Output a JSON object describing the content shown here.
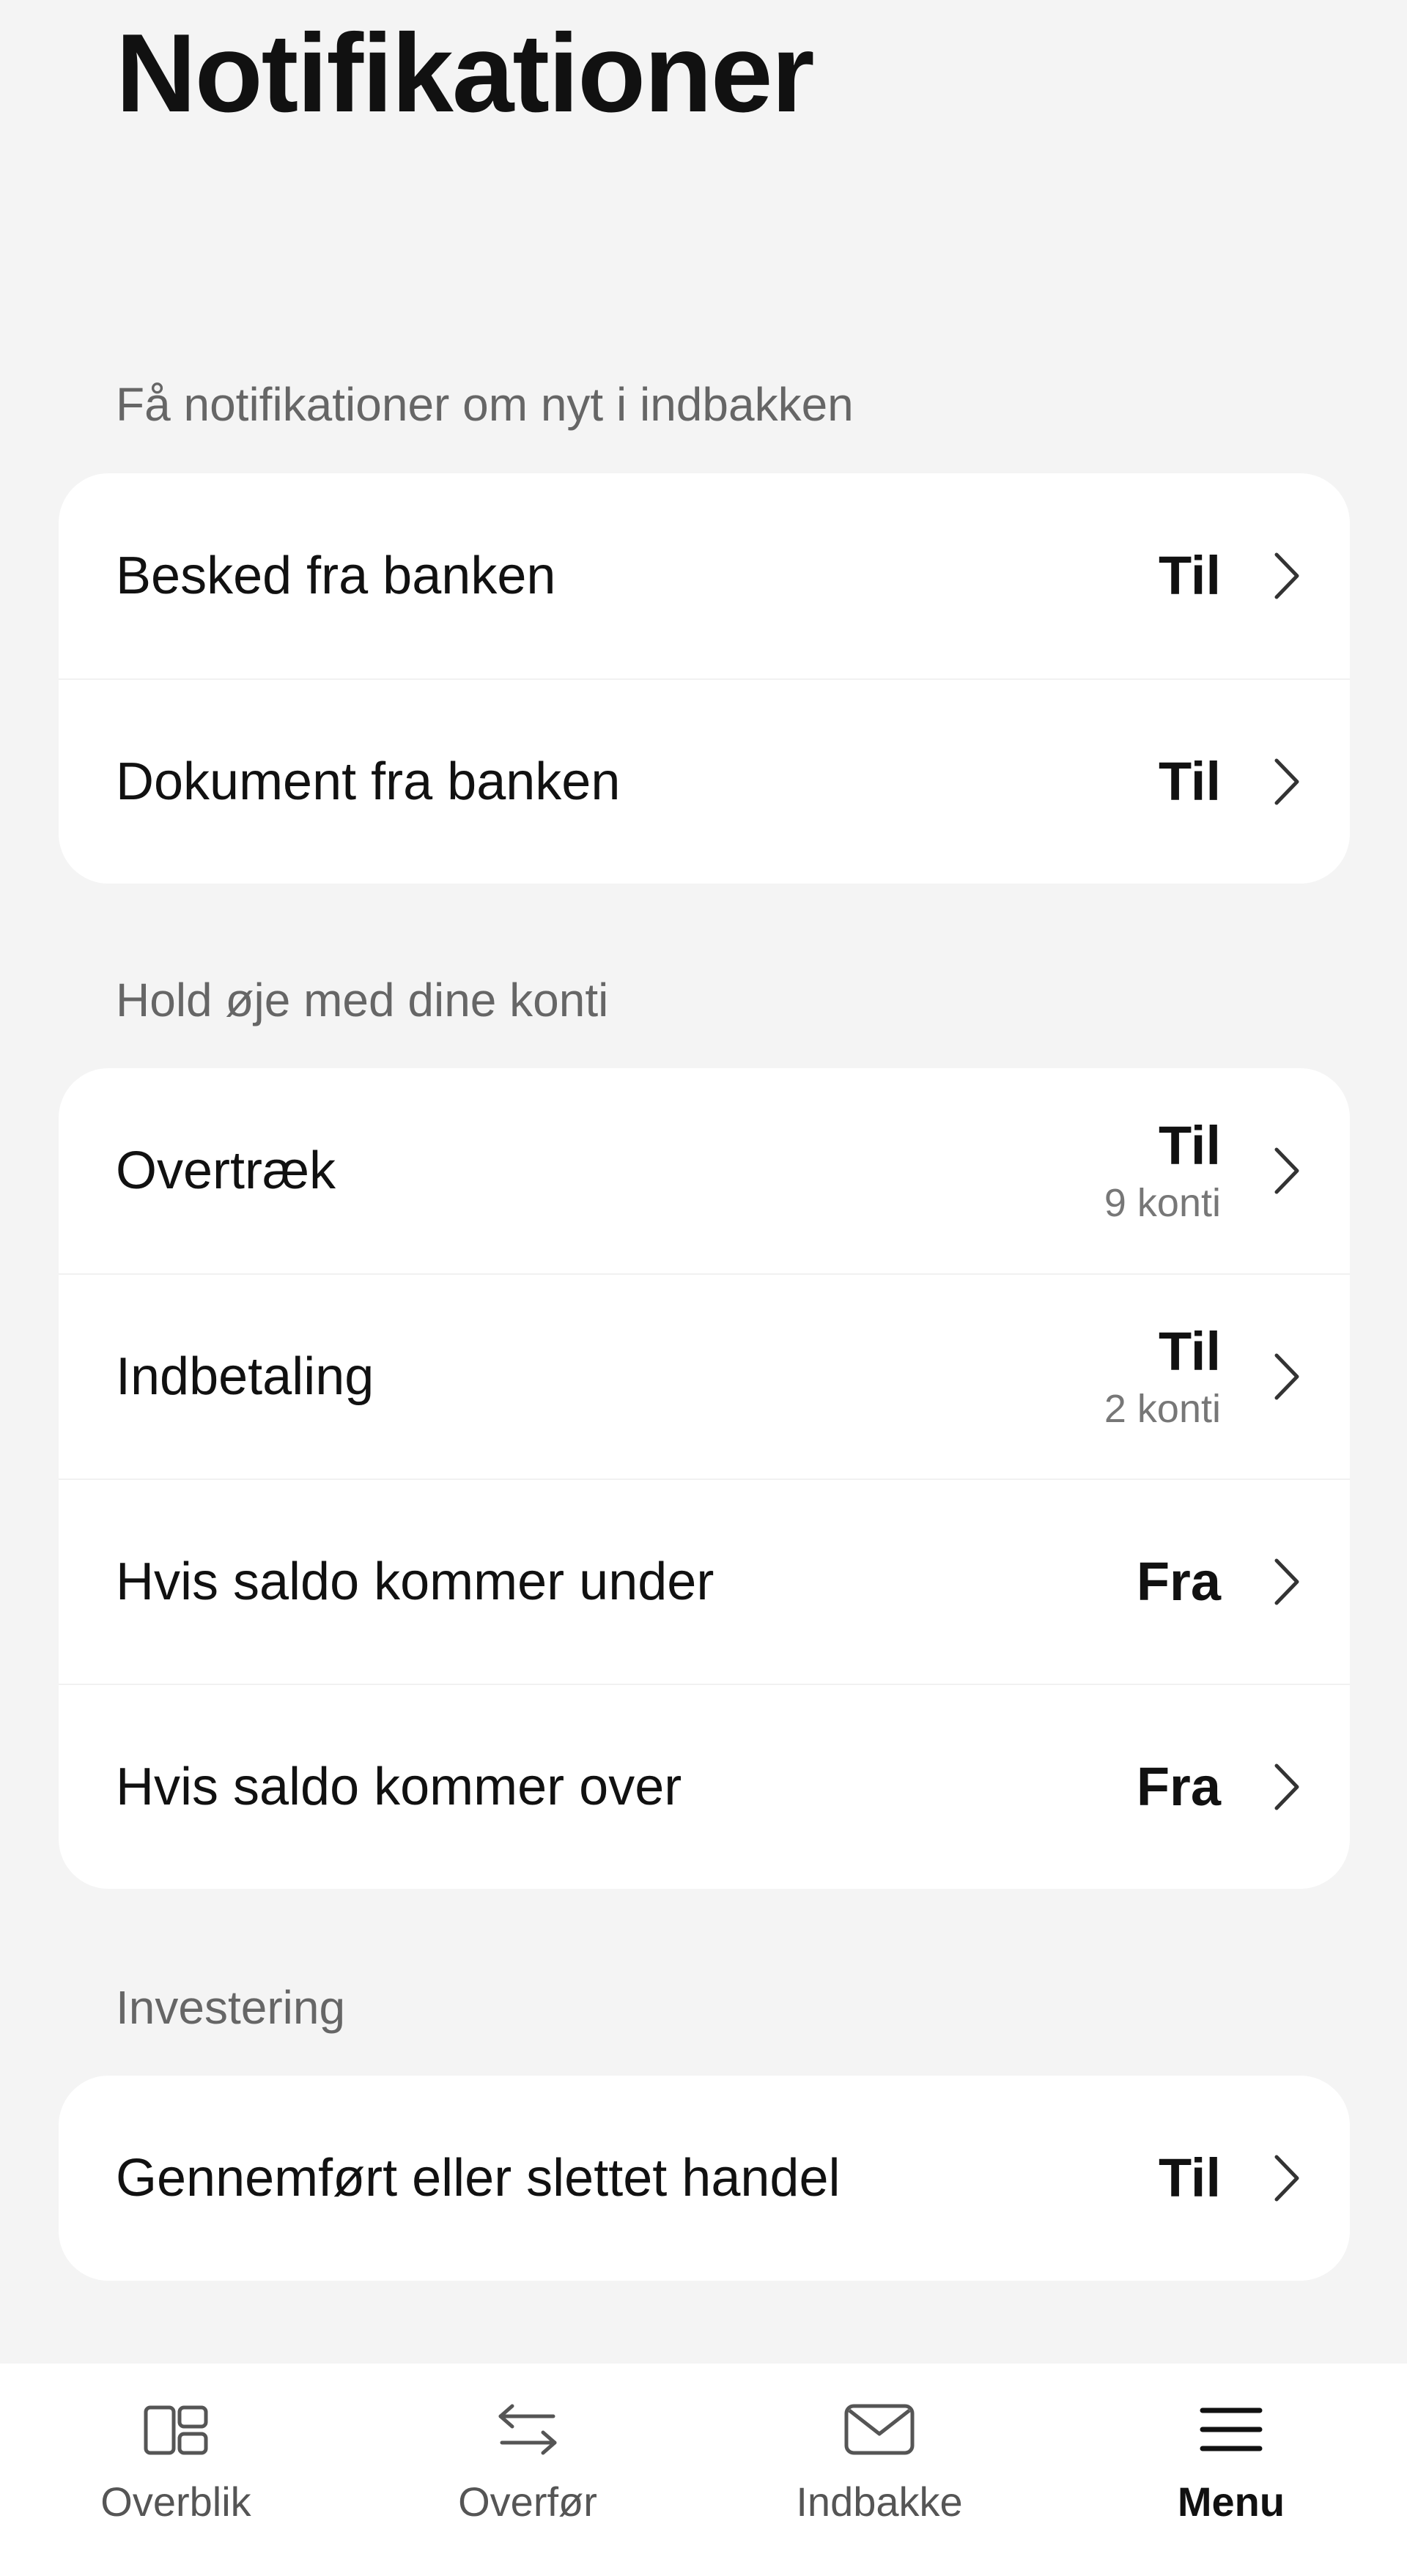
{
  "header": {
    "title": "Notifikationer"
  },
  "sections": [
    {
      "label": "Få notifikationer om nyt i indbakken",
      "rows": [
        {
          "label": "Besked fra banken",
          "status": "Til"
        },
        {
          "label": "Dokument fra banken",
          "status": "Til"
        }
      ]
    },
    {
      "label": "Hold øje med dine konti",
      "rows": [
        {
          "label": "Overtræk",
          "status": "Til",
          "sub": "9 konti"
        },
        {
          "label": "Indbetaling",
          "status": "Til",
          "sub": "2 konti"
        },
        {
          "label": "Hvis saldo kommer under",
          "status": "Fra"
        },
        {
          "label": "Hvis saldo kommer over",
          "status": "Fra"
        }
      ]
    },
    {
      "label": "Investering",
      "rows": [
        {
          "label": "Gennemført eller slettet handel",
          "status": "Til"
        }
      ]
    }
  ],
  "tabbar": {
    "items": [
      {
        "label": "Overblik",
        "icon": "overview-icon"
      },
      {
        "label": "Overfør",
        "icon": "transfer-arrows-icon"
      },
      {
        "label": "Indbakke",
        "icon": "envelope-icon"
      },
      {
        "label": "Menu",
        "icon": "hamburger-menu-icon",
        "active": true
      }
    ]
  },
  "colors": {
    "background": "#f4f4f4",
    "card": "#ffffff",
    "text": "#111111",
    "muted": "#666666"
  }
}
